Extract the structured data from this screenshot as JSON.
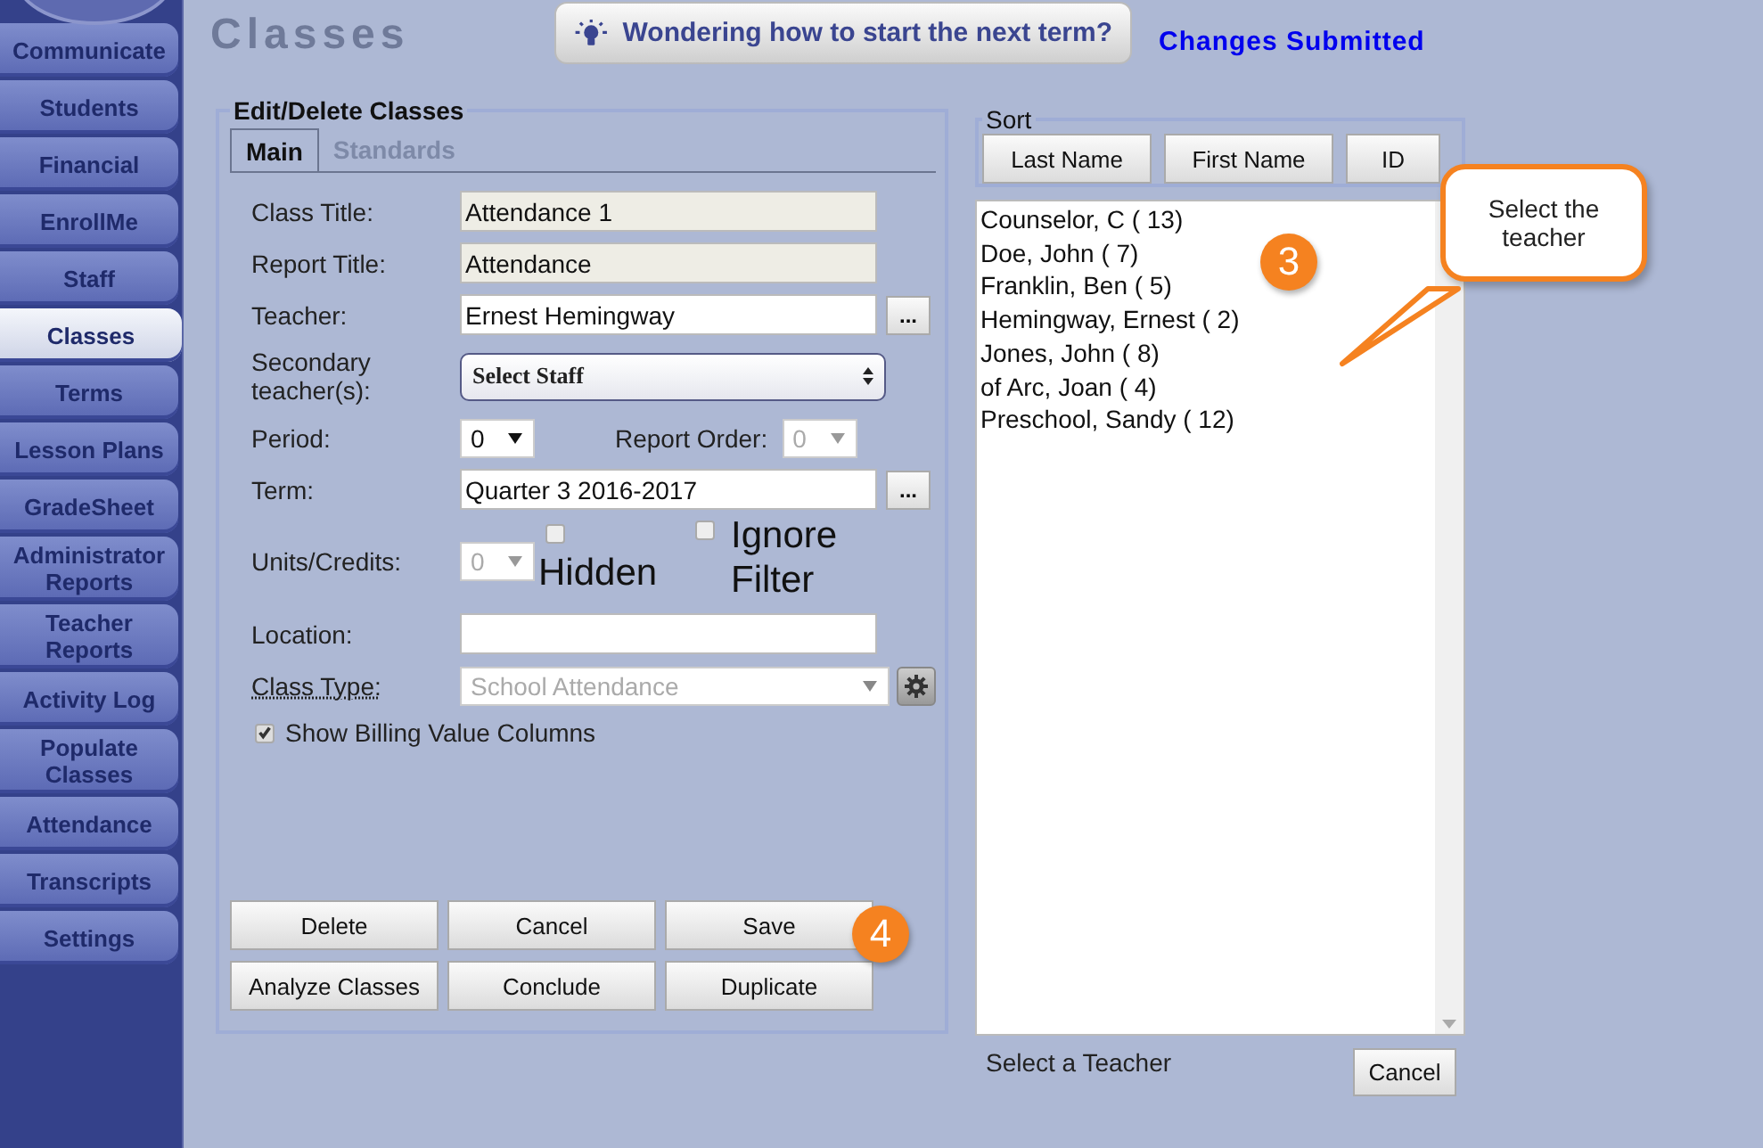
{
  "sidebar": {
    "items": [
      {
        "label": "Communicate",
        "selected": false
      },
      {
        "label": "Students",
        "selected": false
      },
      {
        "label": "Financial",
        "selected": false
      },
      {
        "label": "EnrollMe",
        "selected": false
      },
      {
        "label": "Staff",
        "selected": false
      },
      {
        "label": "Classes",
        "selected": true
      },
      {
        "label": "Terms",
        "selected": false
      },
      {
        "label": "Lesson Plans",
        "selected": false
      },
      {
        "label": "GradeSheet",
        "selected": false
      },
      {
        "label": "Administrator Reports",
        "selected": false
      },
      {
        "label": "Teacher Reports",
        "selected": false
      },
      {
        "label": "Activity Log",
        "selected": false
      },
      {
        "label": "Populate Classes",
        "selected": false
      },
      {
        "label": "Attendance",
        "selected": false
      },
      {
        "label": "Transcripts",
        "selected": false
      },
      {
        "label": "Settings",
        "selected": false
      }
    ]
  },
  "page_title": "Classes",
  "tip_button": "Wondering how to start the next term?",
  "status": "Changes Submitted",
  "edit_panel": {
    "legend": "Edit/Delete Classes",
    "tabs": [
      {
        "label": "Main",
        "selected": true
      },
      {
        "label": "Standards",
        "selected": false
      }
    ],
    "fields": [
      {
        "kind": "text",
        "label": "Class Title:",
        "value": "Attendance 1",
        "readonly": true
      },
      {
        "kind": "text",
        "label": "Report Title:",
        "value": "Attendance",
        "readonly": true
      },
      {
        "kind": "picker",
        "label": "Teacher:",
        "value": "Ernest Hemingway",
        "button": "..."
      },
      {
        "kind": "multiselect",
        "label": "Secondary teacher(s):",
        "value": "Select Staff"
      },
      {
        "kind": "period",
        "label": "Period:",
        "value": "0",
        "order_label": "Report Order:",
        "order_value": "0",
        "order_disabled": true
      },
      {
        "kind": "picker",
        "label": "Term:",
        "value": "Quarter 3 2016-2017",
        "button": "..."
      },
      {
        "kind": "units",
        "label": "Units/Credits:",
        "value": "0",
        "disabled": true,
        "checks": [
          {
            "label": "Hidden",
            "checked": false
          },
          {
            "label": "Ignore Filter",
            "checked": false
          }
        ]
      },
      {
        "kind": "text",
        "label": "Location:",
        "readonly": false
      },
      {
        "kind": "select",
        "label": "Class Type:",
        "value": "School Attendance",
        "disabled": true
      },
      {
        "kind": "checkbox",
        "label": "Show Billing Value Columns",
        "checked": true
      }
    ],
    "buttons": [
      "Delete",
      "Cancel",
      "Save",
      "Analyze Classes",
      "Conclude",
      "Duplicate"
    ]
  },
  "sort": {
    "legend": "Sort",
    "buttons": [
      "Last Name",
      "First Name",
      "ID"
    ]
  },
  "teacher_list": [
    "Counselor, C ( 13)",
    "Doe, John ( 7)",
    "Franklin, Ben ( 5)",
    "Hemingway, Ernest ( 2)",
    "Jones, John ( 8)",
    "of Arc, Joan ( 4)",
    "Preschool, Sandy ( 12)"
  ],
  "select_prompt": "Select a Teacher",
  "cancel_button": "Cancel",
  "callout": "Select the teacher",
  "step_badges": [
    "3",
    "4"
  ]
}
